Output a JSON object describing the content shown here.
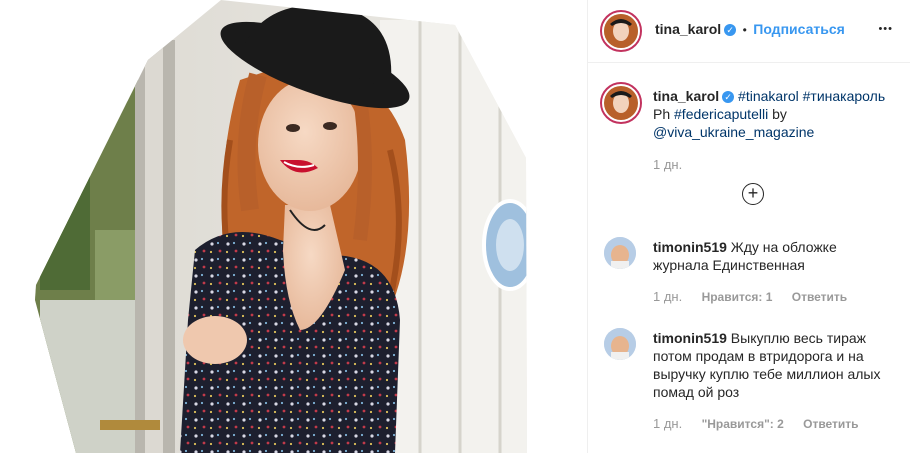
{
  "post": {
    "username": "tina_karol",
    "verified_icon": "verified-badge-icon",
    "follow_separator": "•",
    "follow_label": "Подписаться",
    "more_icon": "more-options-icon",
    "more_glyph": "•••"
  },
  "caption": {
    "username": "tina_karol",
    "tag1": "#tinakarol",
    "tag2": "#тинакароль",
    "line2_prefix": "Ph",
    "tag3": "#federicaputelli",
    "line2_suffix": "by",
    "mention": "@viva_ukraine_magazine",
    "time": "1 дн."
  },
  "load_more_icon": "plus-circle-icon",
  "load_more_glyph": "+",
  "comments": [
    {
      "username": "timonin519",
      "text": "Жду на обложке журнала Единственная",
      "time": "1 дн.",
      "likes": "Нравится: 1",
      "reply": "Ответить"
    },
    {
      "username": "timonin519",
      "text": "Выкуплю весь тираж потом продам в втридорога и на выручку куплю тебе миллион алых помад ой роз",
      "time": "1 дн.",
      "likes": "\"Нравится\": 2",
      "reply": "Ответить"
    }
  ],
  "colors": {
    "accent_blue": "#3897f0",
    "tag_blue": "#003569",
    "meta_gray": "#999999",
    "hat": "#1a1a1a",
    "hair": "#c0652a",
    "dress": "#1d1f2e",
    "lips": "#c8102e"
  }
}
